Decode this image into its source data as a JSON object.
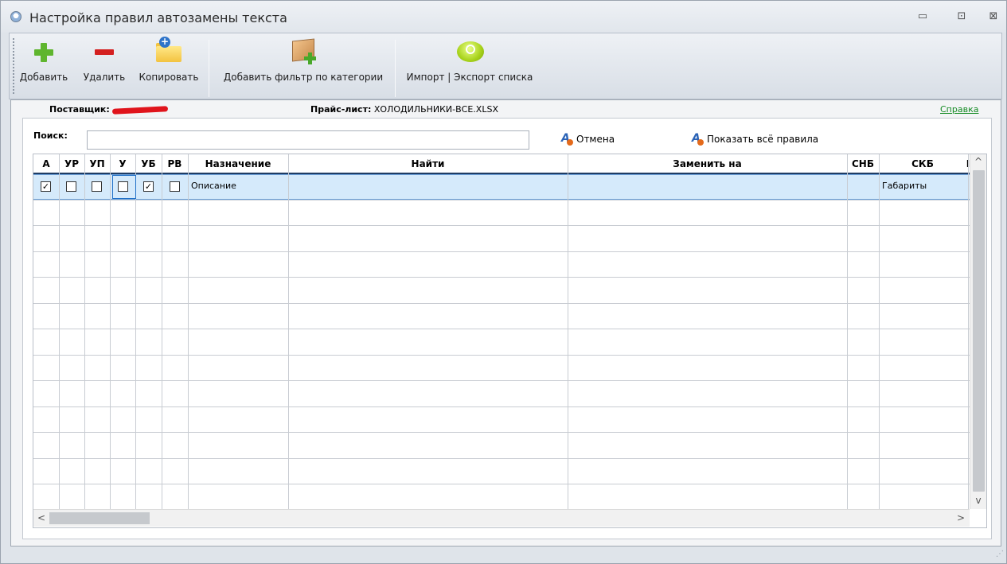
{
  "window": {
    "title": "Настройка правил автозамены текста",
    "minimize_glyph": "▭",
    "maximize_glyph": "⊡",
    "close_glyph": "⊠"
  },
  "toolbar": {
    "add_label": "Добавить",
    "delete_label": "Удалить",
    "copy_label": "Копировать",
    "add_filter_label": "Добавить фильтр по категории",
    "import_export_label": "Импорт | Экспорт списка"
  },
  "info": {
    "supplier_label": "Поставщик:",
    "pricelist_label": "Прайс-лист:",
    "pricelist_value": "ХОЛОДИЛЬНИКИ-ВСЕ.XLSX",
    "help_link": "Справка"
  },
  "search": {
    "label": "Поиск:",
    "value": "",
    "placeholder": ""
  },
  "actions": {
    "cancel_label": "Отмена",
    "show_all_label": "Показать всё правила"
  },
  "grid": {
    "columns": [
      "А",
      "УР",
      "УП",
      "У",
      "УБ",
      "РВ",
      "Назначение",
      "Найти",
      "Заменить на",
      "СНБ",
      "СКБ",
      "I"
    ],
    "rows": [
      {
        "a": true,
        "ur": false,
        "up": false,
        "u": false,
        "ub": true,
        "rv": false,
        "purpose": "Описание",
        "find": "",
        "replace": "",
        "snb": "",
        "skb": "Габариты"
      }
    ],
    "empty_rows": 12
  },
  "scrollbars": {
    "up_arrow": "^",
    "down_arrow": "v",
    "left_arrow": "<",
    "right_arrow": ">"
  }
}
